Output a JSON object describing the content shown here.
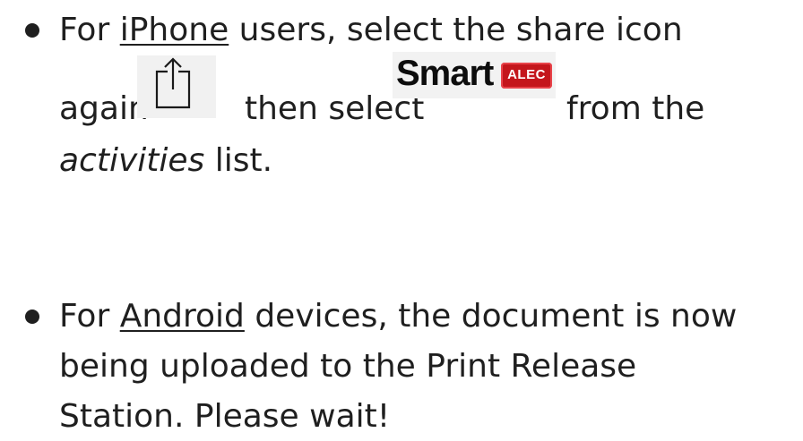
{
  "items": [
    {
      "prefix": "For ",
      "platform": "iPhone",
      "text1": " users, select the share icon",
      "text2": "again",
      "text3": "then select",
      "text4": "from the",
      "activities": "activities",
      "text5": " list.",
      "share_icon": "share-icon",
      "logo": {
        "word": "Smart",
        "badge": "ALEC",
        "badge_color": "#c4161c"
      }
    },
    {
      "prefix": "For ",
      "platform": "Android",
      "text1": " devices, the document is now",
      "line2": "being uploaded to the Print Release",
      "line3": "Station. Please wait!"
    }
  ]
}
